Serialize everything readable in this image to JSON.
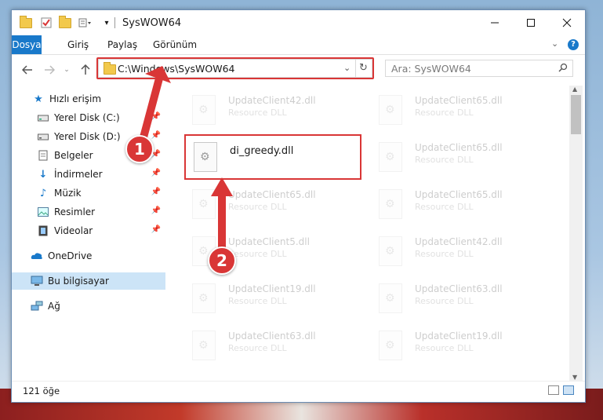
{
  "window": {
    "title": "SysWOW64"
  },
  "ribbon": {
    "tabs": [
      "Dosya",
      "Giriş",
      "Paylaş",
      "Görünüm"
    ]
  },
  "address": {
    "path": "C:\\Windows\\SysWOW64"
  },
  "search": {
    "placeholder": "Ara: SysWOW64"
  },
  "sidebar": {
    "items": [
      {
        "label": "Hızlı erişim",
        "icon": "star-icon"
      },
      {
        "label": "Yerel Disk (C:)",
        "icon": "drive-icon"
      },
      {
        "label": "Yerel Disk (D:)",
        "icon": "drive-icon"
      },
      {
        "label": "Belgeler",
        "icon": "documents-icon"
      },
      {
        "label": "İndirmeler",
        "icon": "download-icon"
      },
      {
        "label": "Müzik",
        "icon": "music-icon"
      },
      {
        "label": "Resimler",
        "icon": "pictures-icon"
      },
      {
        "label": "Videolar",
        "icon": "videos-icon"
      },
      {
        "label": "OneDrive",
        "icon": "cloud-icon"
      },
      {
        "label": "Bu bilgisayar",
        "icon": "computer-icon"
      },
      {
        "label": "Ağ",
        "icon": "network-icon"
      }
    ]
  },
  "files": {
    "highlighted": {
      "name": "di_greedy.dll"
    },
    "col1": [
      {
        "name": "UpdateClient42.dll",
        "desc": "Resource DLL"
      },
      {
        "name": "UpdateClient65.dll",
        "desc": "Resource DLL"
      },
      {
        "name": "UpdateClient5.dll",
        "desc": "Resource DLL"
      },
      {
        "name": "UpdateClient19.dll",
        "desc": "Resource DLL"
      },
      {
        "name": "UpdateClient63.dll",
        "desc": "Resource DLL"
      }
    ],
    "col2": [
      {
        "name": "UpdateClient65.dll",
        "desc": "Resource DLL"
      },
      {
        "name": "UpdateClient65.dll",
        "desc": "Resource DLL"
      },
      {
        "name": "UpdateClient65.dll",
        "desc": "Resource DLL"
      },
      {
        "name": "UpdateClient42.dll",
        "desc": "Resource DLL"
      },
      {
        "name": "UpdateClient63.dll",
        "desc": "Resource DLL"
      },
      {
        "name": "UpdateClient19.dll",
        "desc": "Resource DLL"
      }
    ]
  },
  "status": {
    "count": "121 öğe"
  },
  "callouts": [
    "1",
    "2"
  ],
  "colors": {
    "accent": "#1979ca",
    "highlight": "#d93636",
    "selected": "#cce4f7"
  }
}
